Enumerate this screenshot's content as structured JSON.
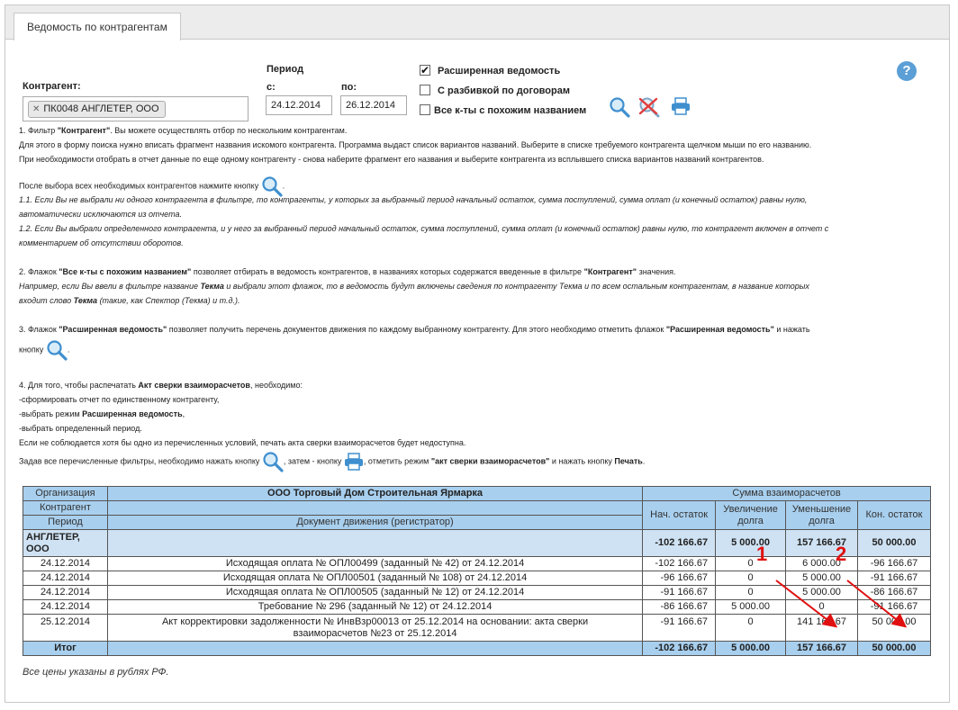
{
  "tab": {
    "label": "Ведомость по контрагентам"
  },
  "filter": {
    "kontragent_label": "Контрагент:",
    "chip_label": "ПК0048 АНГЛЕТЕР, ООО",
    "period_label": "Период",
    "from_label": "с:",
    "to_label": "по:",
    "from_value": "24.12.2014",
    "to_value": "26.12.2014",
    "extended_label": "Расширенная ведомость",
    "by_contracts_label": "С разбивкой по договорам",
    "similar_label": "Все к-ты с похожим названием"
  },
  "help": {
    "glyph": "?"
  },
  "help_text": {
    "l1a": "1. Фильтр ",
    "l1b": "\"Контрагент\"",
    "l1c": ". Вы можете осуществлять отбор по нескольким контрагентам.",
    "l2": "Для этого в форму поиска нужно вписать фрагмент названия искомого контрагента. Программа выдаст список вариантов названий. Выберите в списке требуемого контрагента щелчком мыши по его названию.",
    "l3": "При необходимости отобрать в отчет данные по еще одному контрагенту - снова наберите фрагмент его названия и выберите контрагента из всплывшего списка вариантов названий контрагентов.",
    "l4": "После выбора всех необходимых контрагентов нажмите кнопку",
    "l5": "1.1. Если Вы не выбрали ни одного контрагента в фильтре, то контрагенты, у которых за выбранный период начальный остаток, сумма поступлений, сумма оплат (и конечный остаток) равны нулю,",
    "l6": "автоматически исключаются из отчета.",
    "l7": "1.2. Если Вы выбрали определенного контрагента, и у него за выбранный период начальный остаток, сумма поступлений, сумма оплат (и конечный остаток) равны нулю, то контрагент включен в отчет с",
    "l8": "комментарием об отсутствии оборотов.",
    "l9a": "2. Флажок ",
    "l9b": "\"Все к-ты с похожим названием\"",
    "l9c": " позволяет отбирать в ведомость контрагентов, в названиях которых содержатся введенные в фильтре ",
    "l9d": "\"Контрагент\"",
    "l9e": " значения.",
    "l10a": "Например, если Вы ввели в фильтре название ",
    "l10b": "Текма",
    "l10c": " и выбрали этот флажок, то в ведомость будут включены сведения по контрагенту Текма и по всем остальным контрагентам, в название которых",
    "l11a": "входит слово ",
    "l11b": "Текма",
    "l11c": " (такие, как Спектор (Текма) и т.д.).",
    "l12a": "3. Флажок ",
    "l12b": "\"Расширенная ведомость\"",
    "l12c": " позволяет получить перечень документов движения по каждому выбранному контрагенту. Для этого необходимо отметить флажок ",
    "l12d": "\"Расширенная ведомость\"",
    "l12e": " и нажать",
    "l13": "кнопку",
    "l14a": "4. Для того, чтобы распечатать ",
    "l14b": "Акт сверки взаиморасчетов",
    "l14c": ", необходимо:",
    "l15": "-сформировать отчет по единственному контрагенту,",
    "l16a": "-выбрать режим ",
    "l16b": "Расширенная ведомость",
    "l16c": ",",
    "l17": "-выбрать определенный период.",
    "l18": "Если не соблюдается хотя бы одно из перечисленных условий, печать акта сверки взаиморасчетов будет недоступна.",
    "l19a": "Задав все перечисленные фильтры, необходимо нажать кнопку",
    "l19b": ", затем - кнопку",
    "l19c": ", отметить режим ",
    "l19d": "\"акт сверки взаиморасчетов\"",
    "l19e": " и нажать кнопку ",
    "l19f": "Печать",
    "dot": "."
  },
  "report": {
    "org_label": "Организация",
    "org_value": "ООО Торговый Дом Строительная Ярмарка",
    "sum_header": "Сумма взаиморасчетов",
    "kontragent_label": "Контрагент",
    "period_label": "Период",
    "doc_header": "Документ движения (регистратор)",
    "col_start": "Нач. остаток",
    "col_inc": "Увеличение долга",
    "col_dec": "Уменьшение долга",
    "col_end": "Кон. остаток",
    "group": {
      "name": "АНГЛЕТЕР, ООО",
      "start": "-102 166.67",
      "inc": "5 000.00",
      "dec": "157 166.67",
      "end": "50 000.00"
    },
    "rows": [
      {
        "date": "24.12.2014",
        "doc": "Исходящая оплата № ОПЛ00499 (заданный № 42) от 24.12.2014",
        "start": "-102 166.67",
        "inc": "0",
        "dec": "6 000.00",
        "end": "-96 166.67"
      },
      {
        "date": "24.12.2014",
        "doc": "Исходящая оплата № ОПЛ00501 (заданный № 108) от 24.12.2014",
        "start": "-96 166.67",
        "inc": "0",
        "dec": "5 000.00",
        "end": "-91 166.67"
      },
      {
        "date": "24.12.2014",
        "doc": "Исходящая оплата № ОПЛ00505 (заданный № 12) от 24.12.2014",
        "start": "-91 166.67",
        "inc": "0",
        "dec": "5 000.00",
        "end": "-86 166.67"
      },
      {
        "date": "24.12.2014",
        "doc": "Требование № 296 (заданный № 12) от 24.12.2014",
        "start": "-86 166.67",
        "inc": "5 000.00",
        "dec": "0",
        "end": "-91 166.67"
      },
      {
        "date": "25.12.2014",
        "doc_l1": "Акт корректировки задолженности № ИнвВзр00013 от 25.12.2014 на основании: акта сверки",
        "doc_l2": "взаиморасчетов №23 от 25.12.2014",
        "start": "-91 166.67",
        "inc": "0",
        "dec": "141 166.67",
        "end": "50 000.00"
      }
    ],
    "total": {
      "label": "Итог",
      "start": "-102 166.67",
      "inc": "5 000.00",
      "dec": "157 166.67",
      "end": "50 000.00"
    },
    "note": "Все цены указаны в рублях РФ."
  },
  "annotations": {
    "a1": "1",
    "a2": "2",
    "color": "#e01010"
  },
  "colors": {
    "header_blue": "#a8cfee",
    "group_blue": "#cfe2f3",
    "accent": "#5b9fd6"
  }
}
